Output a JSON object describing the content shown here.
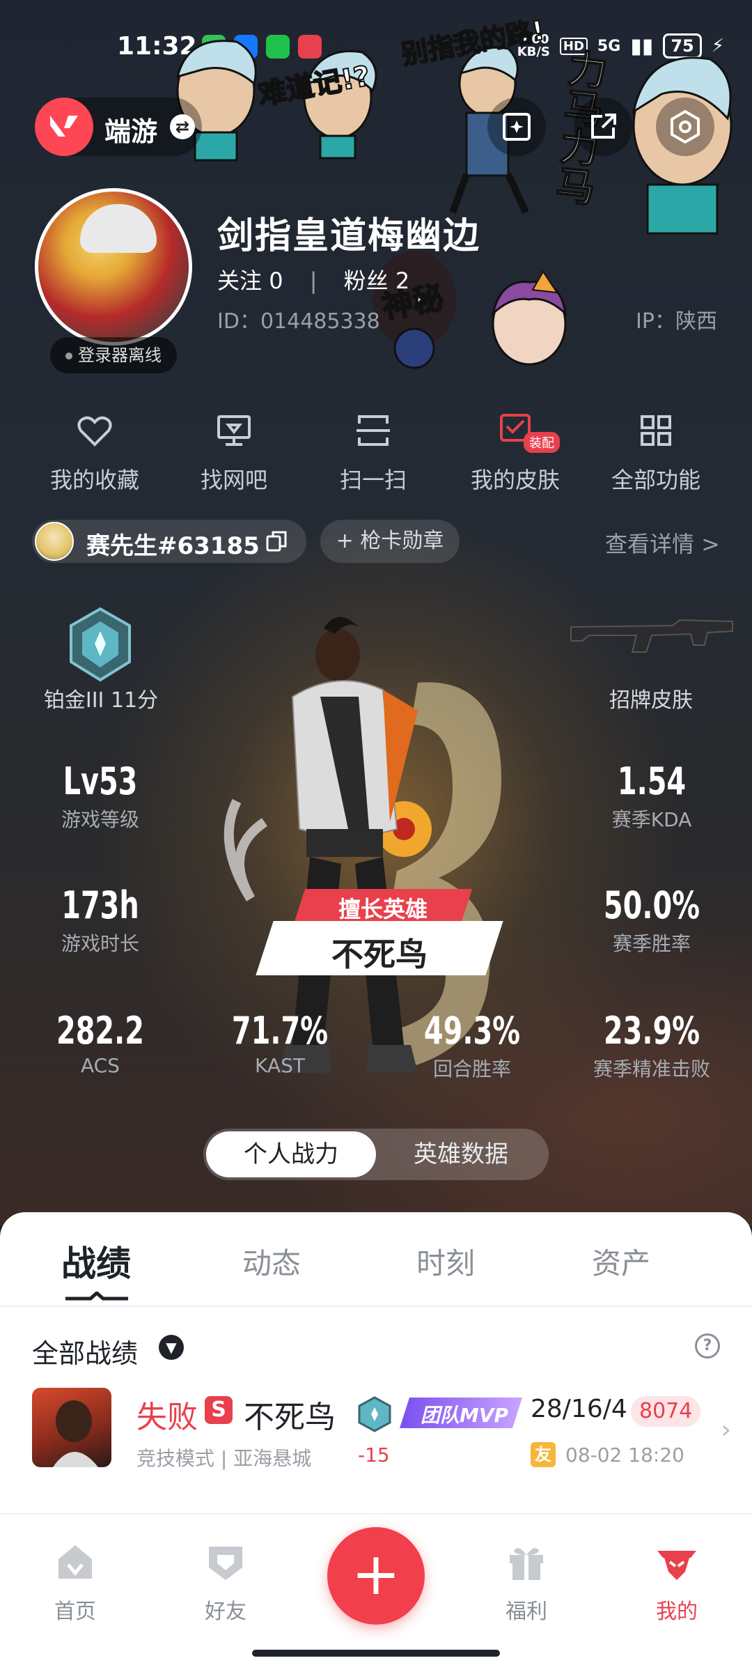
{
  "status_bar": {
    "time": "11:32",
    "net_speed": "0.00\nKB/S",
    "hd": "HD",
    "signal": "5G",
    "battery": "75"
  },
  "header": {
    "game_name": "端游",
    "game_logo": "valorant-logo-icon",
    "buttons": [
      "add-post-icon",
      "share-icon",
      "settings-icon"
    ]
  },
  "profile": {
    "nickname": "剑指皇道梅幽边",
    "follow_label": "关注",
    "follow_count": "0",
    "fans_label": "粉丝",
    "fans_count": "2",
    "id_label": "ID：",
    "id_value": "014485338",
    "ip_label": "IP：",
    "ip_value": "陕西",
    "login_status": "登录器离线"
  },
  "stickers": {
    "text1": "难道记!?",
    "text2": "别指我的路!",
    "text3": "力马力马",
    "text4": "神秘"
  },
  "quick_menu": [
    {
      "label": "我的收藏",
      "icon": "heart-icon"
    },
    {
      "label": "找网吧",
      "icon": "monitor-icon"
    },
    {
      "label": "扫一扫",
      "icon": "scan-icon"
    },
    {
      "label": "我的皮肤",
      "icon": "skin-icon",
      "badge": "装配"
    },
    {
      "label": "全部功能",
      "icon": "grid-icon"
    }
  ],
  "riot": {
    "name": "赛先生#63185",
    "card_button": "+ 枪卡勋章",
    "detail_link": "查看详情 >"
  },
  "stats": {
    "rank": "铂金III 11分",
    "skin": "招牌皮肤",
    "level_value": "Lv53",
    "level_label": "游戏等级",
    "kda_value": "1.54",
    "kda_label": "赛季KDA",
    "time_value": "173h",
    "time_label": "游戏时长",
    "winrate_value": "50.0%",
    "winrate_label": "赛季胜率",
    "acs_value": "282.2",
    "acs_label": "ACS",
    "kast_value": "71.7%",
    "kast_label": "KAST",
    "round_value": "49.3%",
    "round_label": "回合胜率",
    "hs_value": "23.9%",
    "hs_label": "赛季精准击败"
  },
  "hero": {
    "tag": "擅长英雄",
    "name": "不死鸟"
  },
  "segment": {
    "active": "个人战力",
    "inactive": "英雄数据"
  },
  "tabs": [
    "战绩",
    "动态",
    "时刻",
    "资产"
  ],
  "records": {
    "filter": "全部战绩",
    "match": {
      "result": "失败",
      "badge": "S",
      "agent": "不死鸟",
      "mode": "竞技模式 | 亚海悬城",
      "delta": "-15",
      "mvp": "团队MVP",
      "kda": "28/16/4",
      "score": "8074",
      "friend": "友",
      "time": "08-02 18:20"
    }
  },
  "bottom_nav": [
    {
      "label": "首页",
      "icon": "home-icon"
    },
    {
      "label": "好友",
      "icon": "friends-icon"
    },
    {
      "label": "福利",
      "icon": "gift-icon"
    },
    {
      "label": "我的",
      "icon": "me-icon",
      "active": true
    }
  ],
  "colors": {
    "accent": "#e8404c",
    "panel": "#ffffff",
    "hero_bg": "#1f2631"
  }
}
